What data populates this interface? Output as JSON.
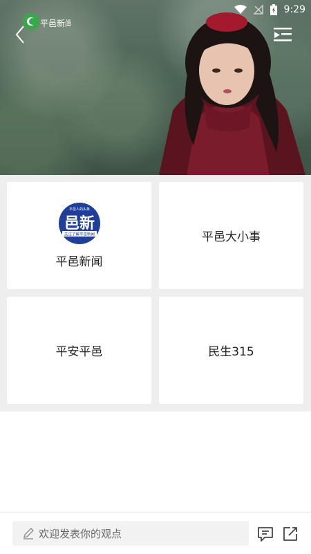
{
  "status_bar": {
    "time": "9:29"
  },
  "video": {
    "channel_logo_text": "平邑新闻",
    "icons": [
      "back-arrow-icon",
      "playlist-icon",
      "wifi-icon",
      "no-signal-icon",
      "battery-icon"
    ]
  },
  "cards": [
    {
      "label": "平邑新闻",
      "logo": {
        "text": "邑新",
        "tagline": "平邑人的头条",
        "subtitle": "关注了解平邑新闻"
      }
    },
    {
      "label": "平邑大小事"
    },
    {
      "label": "平安平邑"
    },
    {
      "label": "民生315"
    }
  ],
  "bottom_bar": {
    "comment_placeholder": "欢迎发表你的观点",
    "icons": [
      "pencil-icon",
      "comment-list-icon",
      "share-icon"
    ]
  },
  "colors": {
    "grid_background": "#eeeeee",
    "card_background": "#ffffff",
    "logo_blue": "#1f3f9a"
  }
}
